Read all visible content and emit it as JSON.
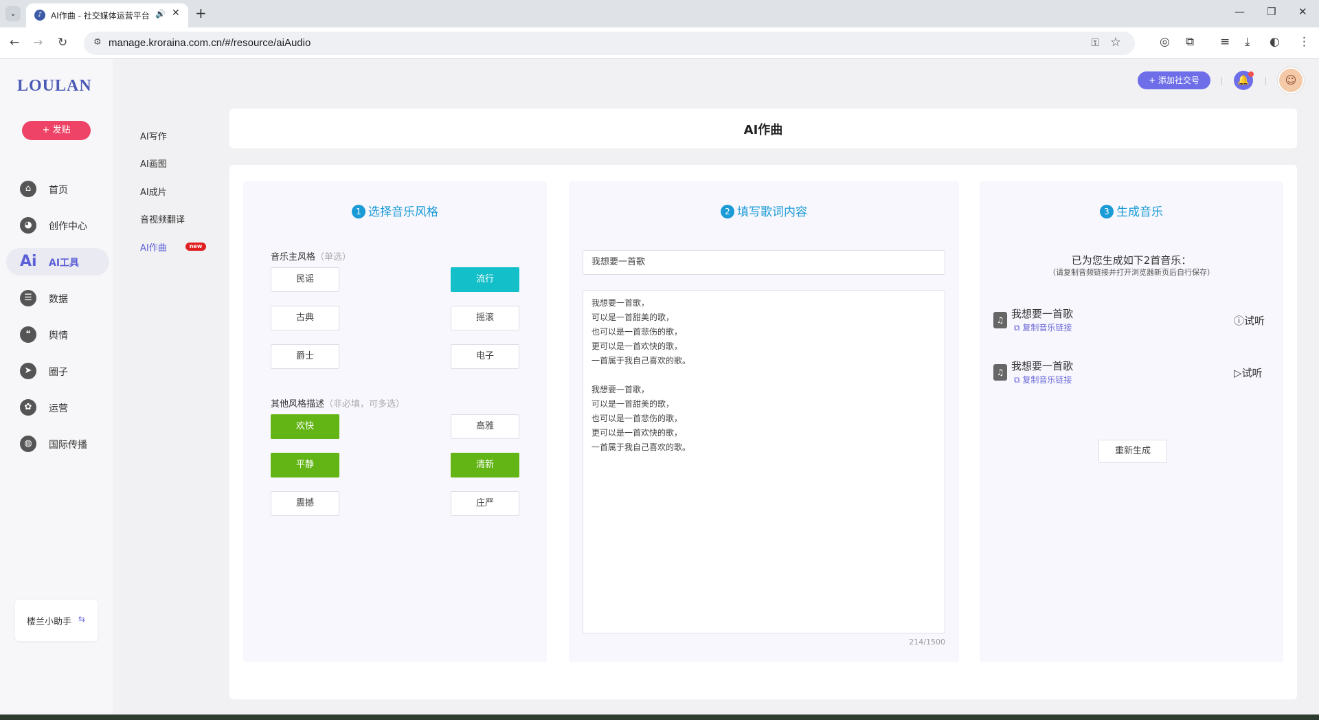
{
  "browser": {
    "dropdown_icon": "⌄",
    "tab_title": "AI作曲 - 社交媒体运营平台",
    "url": "manage.kroraina.com.cn/#/resource/aiAudio"
  },
  "sidebar": {
    "logo": "LOULAN",
    "post_button": "+ 发贴",
    "items": [
      {
        "label": "首页",
        "icon": "home-icon"
      },
      {
        "label": "创作中心",
        "icon": "palette-icon"
      },
      {
        "label": "AI工具",
        "icon": "ai-icon",
        "active": true
      },
      {
        "label": "数据",
        "icon": "database-icon"
      },
      {
        "label": "舆情",
        "icon": "quote-icon"
      },
      {
        "label": "圈子",
        "icon": "compass-icon"
      },
      {
        "label": "运营",
        "icon": "settings-icon"
      },
      {
        "label": "国际传播",
        "icon": "globe-icon"
      }
    ],
    "helper": "楼兰小助手"
  },
  "submenu": {
    "items": [
      "AI写作",
      "AI画图",
      "AI成片",
      "音视频翻译",
      "AI作曲"
    ],
    "active": "AI作曲",
    "badge": "new"
  },
  "header": {
    "add_account_button": "+ 添加社交号"
  },
  "page": {
    "title": "AI作曲"
  },
  "step1": {
    "num": "1",
    "title": "选择音乐风格",
    "main_label": "音乐主风格",
    "main_hint": "（单选）",
    "main_options": [
      "民谣",
      "流行",
      "古典",
      "摇滚",
      "爵士",
      "电子"
    ],
    "main_selected": "流行",
    "other_label": "其他风格描述",
    "other_hint": "（非必填，可多选）",
    "other_options": [
      "欢快",
      "高雅",
      "平静",
      "清新",
      "震撼",
      "庄严"
    ],
    "other_selected": [
      "欢快",
      "平静",
      "清新"
    ]
  },
  "step2": {
    "num": "2",
    "title": "填写歌词内容",
    "title_input_value": "我想要一首歌",
    "lyrics": "我想要一首歌，\n可以是一首甜美的歌，\n也可以是一首悲伤的歌，\n更可以是一首欢快的歌，\n一首属于我自己喜欢的歌。\n\n我想要一首歌，\n可以是一首甜美的歌，\n也可以是一首悲伤的歌，\n更可以是一首欢快的歌，\n一首属于我自己喜欢的歌。",
    "counter": "214/1500"
  },
  "step3": {
    "num": "3",
    "title": "生成音乐",
    "summary": "已为您生成如下2首音乐：",
    "note": "（请复制音频链接并打开浏览器新页后自行保存）",
    "songs": [
      {
        "name": "我想要一首歌",
        "copy_label": "复制音乐链接",
        "play_label": "试听"
      },
      {
        "name": "我想要一首歌",
        "copy_label": "复制音乐链接",
        "play_label": "试听"
      }
    ],
    "regenerate_button": "重新生成"
  },
  "colors": {
    "accent": "#5c5fd8",
    "step_blue": "#1a9bd6",
    "teal_selected": "#13bfc8",
    "green_selected": "#63b515",
    "post_red": "#ee4266"
  }
}
